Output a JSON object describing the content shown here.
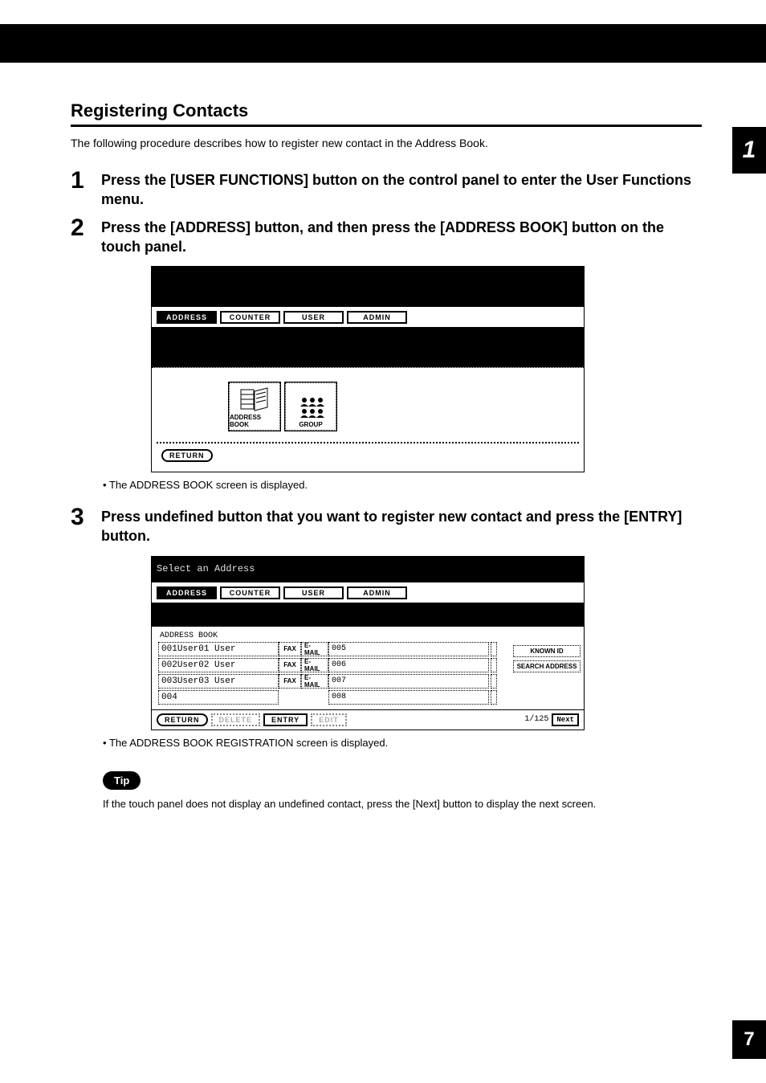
{
  "side_tab": "1",
  "page_number": "7",
  "section_title": "Registering Contacts",
  "intro": "The following procedure describes how to register new contact in the Address Book.",
  "steps": {
    "s1_n": "1",
    "s1_t": "Press the [USER FUNCTIONS] button on the control panel to enter the User Functions menu.",
    "s2_n": "2",
    "s2_t": "Press the [ADDRESS] button, and then press the [ADDRESS BOOK] button on the touch panel.",
    "s3_n": "3",
    "s3_t": "Press undefined button that you want to register new contact and press the [ENTRY] button."
  },
  "bullet1": "The ADDRESS BOOK screen is displayed.",
  "bullet2": "The ADDRESS BOOK REGISTRATION screen is displayed.",
  "tip_label": "Tip",
  "tip_text": "If the touch panel does not display an undefined contact, press the [Next] button to display the next screen.",
  "shot1": {
    "tabs": [
      "ADDRESS",
      "COUNTER",
      "USER",
      "ADMIN"
    ],
    "icon1_label": "ADDRESS BOOK",
    "icon2_label": "GROUP",
    "return": "RETURN"
  },
  "shot2": {
    "title": "Select an Address",
    "tabs": [
      "ADDRESS",
      "COUNTER",
      "USER",
      "ADMIN"
    ],
    "subtitle": "ADDRESS BOOK",
    "rows": [
      {
        "id": "001",
        "name": "User01 User",
        "fax": "FAX",
        "email": "E-MAIL",
        "n2": "005"
      },
      {
        "id": "002",
        "name": "User02 User",
        "fax": "FAX",
        "email": "E-MAIL",
        "n2": "006"
      },
      {
        "id": "003",
        "name": "User03 User",
        "fax": "FAX",
        "email": "E-MAIL",
        "n2": "007"
      },
      {
        "id": "004",
        "name": "",
        "fax": "",
        "email": "",
        "n2": "008"
      }
    ],
    "side_known": "KNOWN ID",
    "side_search": "SEARCH ADDRESS",
    "footer": {
      "return": "RETURN",
      "delete": "DELETE",
      "entry": "ENTRY",
      "edit": "EDIT",
      "pager": "1/125",
      "next": "Next"
    }
  }
}
